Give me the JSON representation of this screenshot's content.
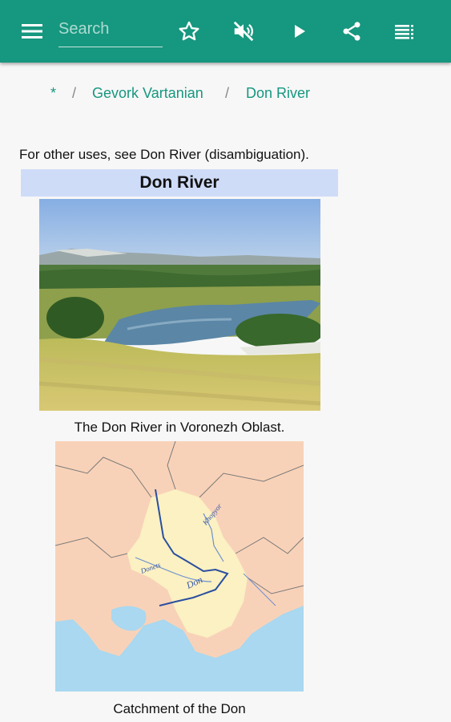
{
  "toolbar": {
    "menu_icon": "hamburger-menu-icon",
    "search_placeholder": "Search",
    "search_value": "",
    "icons": [
      "star-icon",
      "speaker-muted-icon",
      "play-icon",
      "share-icon",
      "list-icon"
    ]
  },
  "breadcrumb": {
    "home": "*",
    "separator": "/",
    "items": [
      "Gevork Vartanian",
      "Don River"
    ]
  },
  "article": {
    "hatnote": "For other uses, see Don River (disambiguation).",
    "infobox_title": "Don River",
    "image1_caption": "The Don River in Voronezh Oblast.",
    "map_labels": [
      "Khopyor",
      "Donets",
      "Don"
    ],
    "image2_caption": "Catchment of the Don"
  },
  "colors": {
    "toolbar": "#16977f",
    "link": "#16977f",
    "infobox_header": "#cfdcf8"
  }
}
